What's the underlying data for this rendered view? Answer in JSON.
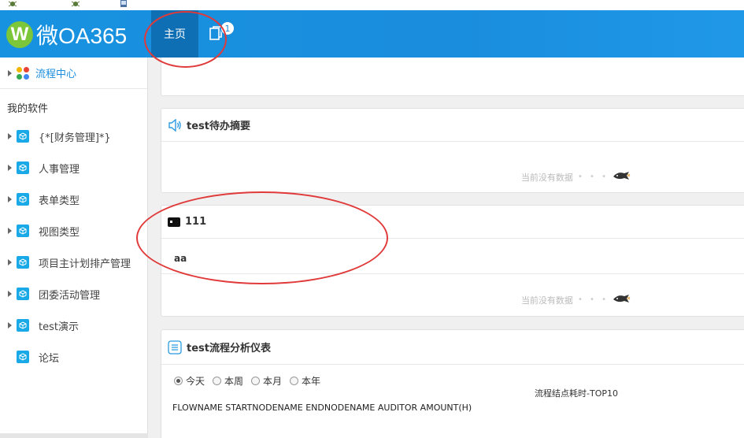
{
  "header": {
    "logo_letter": "W",
    "logo_text": "微OA365",
    "nav_home": "主页",
    "tabs_badge": "1",
    "brand_color": "#1a8ddd"
  },
  "sidebar": {
    "flow_center": "流程中心",
    "section_title": "我的软件",
    "items": [
      {
        "label": "{*[财务管理]*}",
        "expandable": true
      },
      {
        "label": "人事管理",
        "expandable": true
      },
      {
        "label": "表单类型",
        "expandable": true
      },
      {
        "label": "视图类型",
        "expandable": true
      },
      {
        "label": "项目主计划排产管理",
        "expandable": true
      },
      {
        "label": "团委活动管理",
        "expandable": true
      },
      {
        "label": "test演示",
        "expandable": true
      },
      {
        "label": "论坛",
        "expandable": false
      }
    ]
  },
  "main": {
    "panel_todo": {
      "title": "test待办摘要",
      "nodata": "当前没有数据"
    },
    "panel_111": {
      "title": "111",
      "content": "aa",
      "nodata": "当前没有数据"
    },
    "panel_analysis": {
      "title": "test流程分析仪表",
      "radios": [
        {
          "label": "今天",
          "checked": true
        },
        {
          "label": "本周",
          "checked": false
        },
        {
          "label": "本月",
          "checked": false
        },
        {
          "label": "本年",
          "checked": false
        }
      ],
      "chart_title": "流程结点耗时-TOP10",
      "columns": "FLOWNAME STARTNODENAME ENDNODENAME AUDITOR AMOUNT(H)"
    }
  }
}
